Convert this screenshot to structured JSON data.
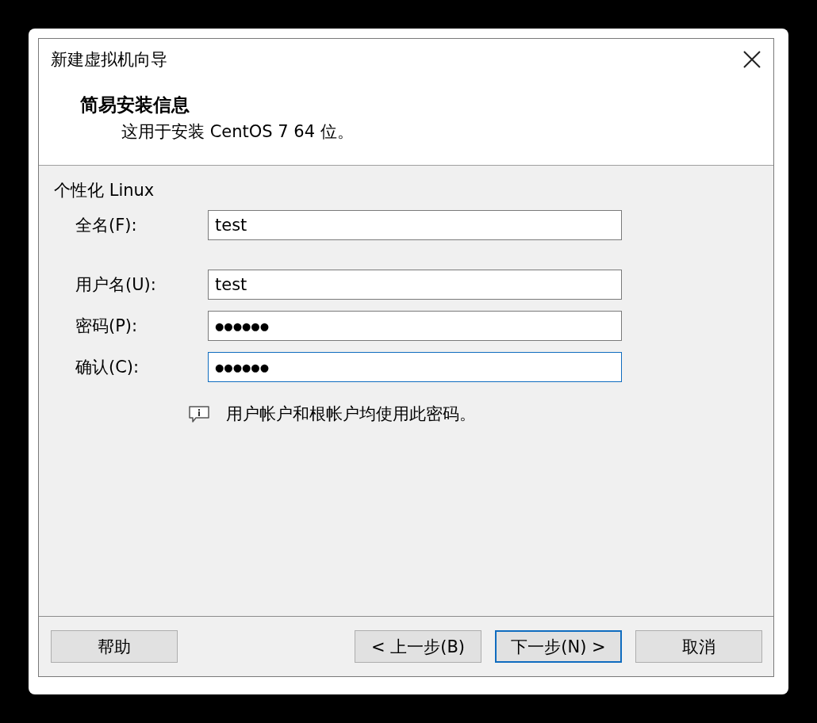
{
  "window": {
    "title": "新建虚拟机向导"
  },
  "header": {
    "title": "简易安装信息",
    "subtitle": "这用于安装 CentOS 7 64 位。"
  },
  "group": {
    "label": "个性化 Linux",
    "fields": [
      {
        "label": "全名(F):",
        "value": "test",
        "kind": "text",
        "focused": false
      },
      {
        "label": "用户名(U):",
        "value": "test",
        "kind": "text",
        "focused": false
      },
      {
        "label": "密码(P):",
        "value": "●●●●●●",
        "kind": "password",
        "focused": false
      },
      {
        "label": "确认(C):",
        "value": "●●●●●●",
        "kind": "password",
        "focused": true
      }
    ],
    "note": "用户帐户和根帐户均使用此密码。"
  },
  "buttons": [
    {
      "label": "帮助",
      "default": false
    },
    {
      "label": "< 上一步(B)",
      "default": false
    },
    {
      "label": "下一步(N) >",
      "default": true
    },
    {
      "label": "取消",
      "default": false
    }
  ]
}
